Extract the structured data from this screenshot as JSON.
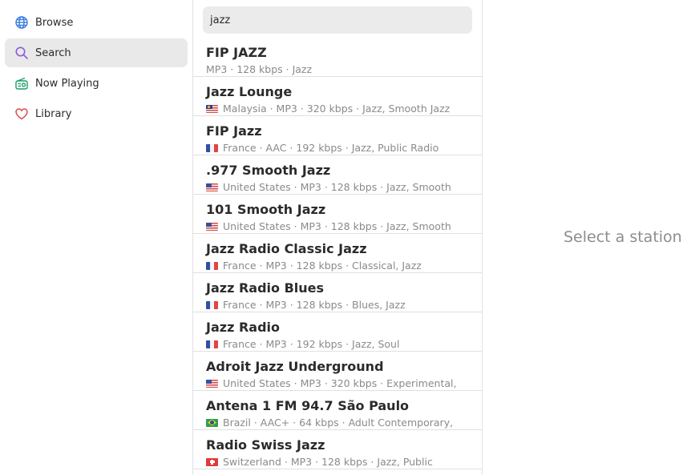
{
  "sidebar": {
    "items": [
      {
        "label": "Browse",
        "icon": "globe-icon",
        "color": "#3b7de0"
      },
      {
        "label": "Search",
        "icon": "search-icon",
        "color": "#8e5bd9"
      },
      {
        "label": "Now Playing",
        "icon": "radio-icon",
        "color": "#1a9e6a"
      },
      {
        "label": "Library",
        "icon": "heart-icon",
        "color": "#e04a4a"
      }
    ],
    "active": "Search"
  },
  "search": {
    "value": "jazz"
  },
  "results": [
    {
      "title": "FIP JAZZ",
      "flag": "",
      "meta": "MP3 · 128 kbps · Jazz"
    },
    {
      "title": "Jazz Lounge",
      "flag": "MY",
      "meta": "Malaysia · MP3 · 320 kbps · Jazz, Smooth Jazz"
    },
    {
      "title": "FIP Jazz",
      "flag": "FR",
      "meta": "France · AAC · 192 kbps · Jazz, Public Radio"
    },
    {
      "title": ".977 Smooth Jazz",
      "flag": "US",
      "meta": "United States · MP3 · 128 kbps · Jazz, Smooth"
    },
    {
      "title": "101 Smooth Jazz",
      "flag": "US",
      "meta": "United States · MP3 · 128 kbps · Jazz, Smooth"
    },
    {
      "title": "Jazz Radio Classic Jazz",
      "flag": "FR",
      "meta": "France · MP3 · 128 kbps · Classical, Jazz"
    },
    {
      "title": "Jazz Radio Blues",
      "flag": "FR",
      "meta": "France · MP3 · 128 kbps · Blues, Jazz"
    },
    {
      "title": "Jazz Radio",
      "flag": "FR",
      "meta": "France · MP3 · 192 kbps · Jazz, Soul"
    },
    {
      "title": "Adroit Jazz Underground",
      "flag": "US",
      "meta": "United States · MP3 · 320 kbps · Experimental,"
    },
    {
      "title": "Antena 1 FM 94.7 São Paulo",
      "flag": "BR",
      "meta": "Brazil · AAC+ · 64 kbps · Adult Contemporary,"
    },
    {
      "title": "Radio Swiss Jazz",
      "flag": "CH",
      "meta": "Switzerland · MP3 · 128 kbps · Jazz, Public"
    }
  ],
  "detail": {
    "empty_label": "Select a station"
  }
}
